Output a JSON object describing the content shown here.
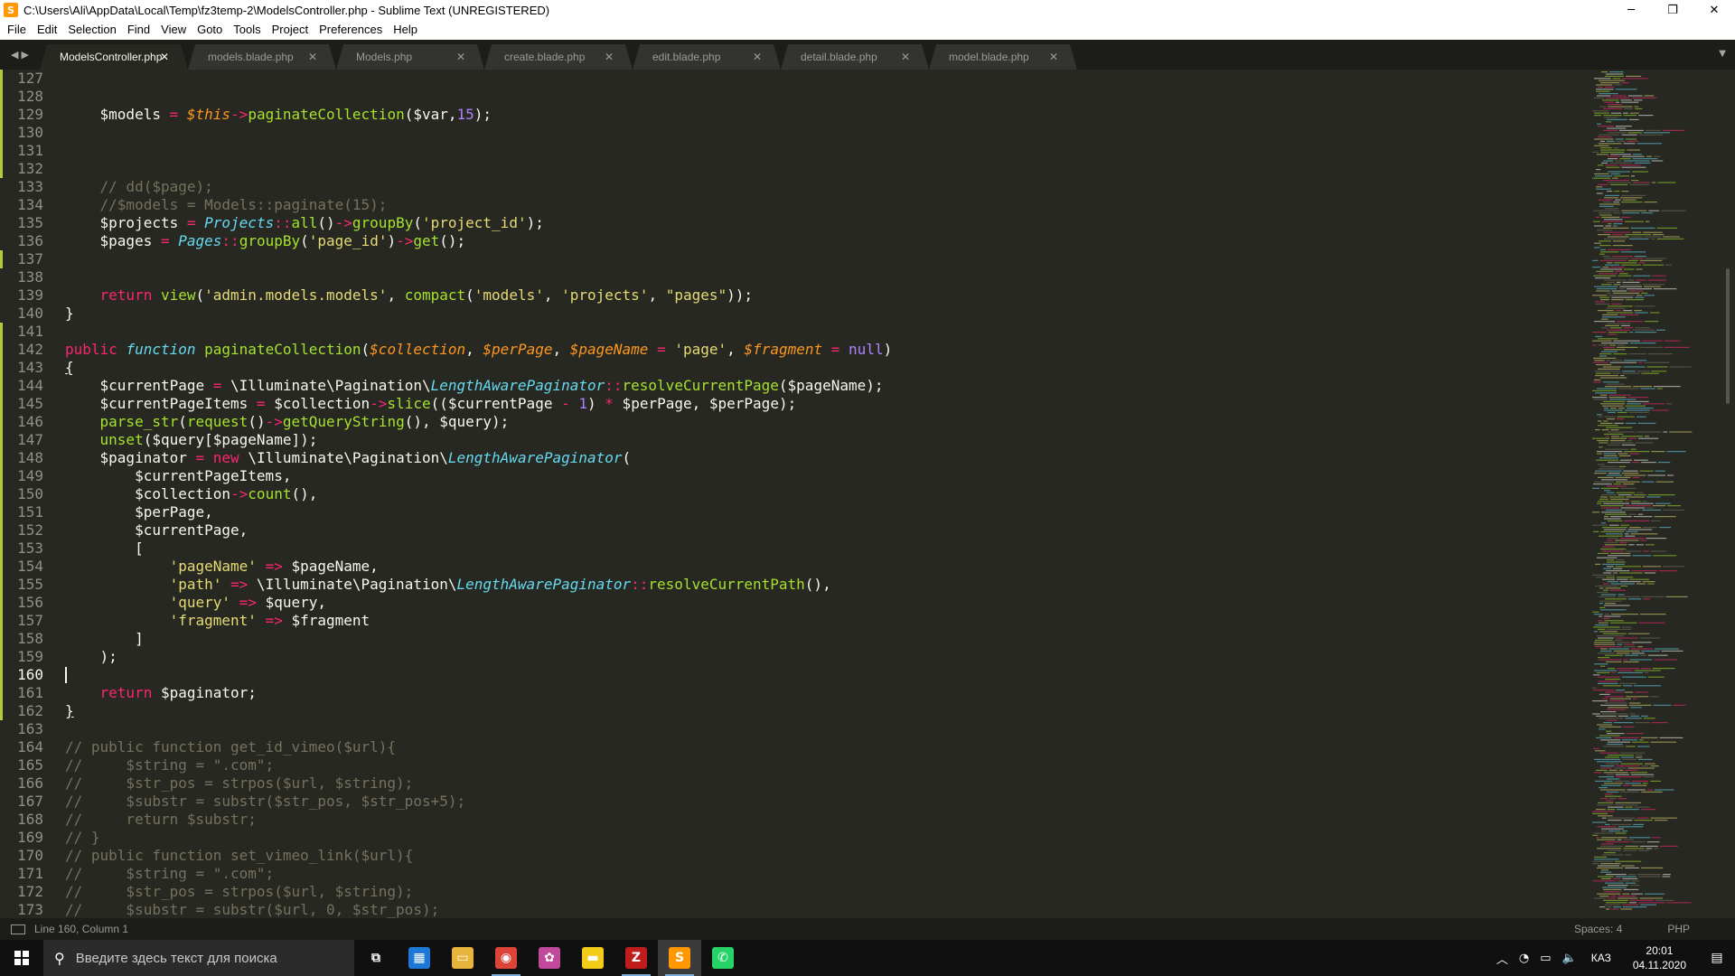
{
  "window": {
    "title": "C:\\Users\\Ali\\AppData\\Local\\Temp\\fz3temp-2\\ModelsController.php - Sublime Text (UNREGISTERED)",
    "app_icon_letter": "S",
    "minimize_glyph": "─",
    "maximize_glyph": "❐",
    "close_glyph": "✕"
  },
  "menu": [
    "File",
    "Edit",
    "Selection",
    "Find",
    "View",
    "Goto",
    "Tools",
    "Project",
    "Preferences",
    "Help"
  ],
  "tabs": [
    {
      "label": "ModelsController.php",
      "active": true
    },
    {
      "label": "models.blade.php",
      "active": false
    },
    {
      "label": "Models.php",
      "active": false
    },
    {
      "label": "create.blade.php",
      "active": false
    },
    {
      "label": "edit.blade.php",
      "active": false
    },
    {
      "label": "detail.blade.php",
      "active": false
    },
    {
      "label": "model.blade.php",
      "active": false
    }
  ],
  "tab_close_glyph": "✕",
  "nav_arrows": "◀ ▶",
  "tab_dropdown_glyph": "▼",
  "editor": {
    "first_line": 127,
    "current_line": 160,
    "modified_lines": [
      127,
      128,
      129,
      130,
      131,
      132,
      137,
      141,
      142,
      143,
      144,
      145,
      146,
      147,
      148,
      149,
      150,
      151,
      152,
      153,
      154,
      155,
      156,
      157,
      158,
      159,
      160,
      161,
      162
    ],
    "lines": [
      [],
      [],
      [
        [
          "    $models ",
          "var"
        ],
        [
          "=",
          "op"
        ],
        [
          " ",
          "var"
        ],
        [
          "$this",
          "this"
        ],
        [
          "->",
          "op"
        ],
        [
          "paginateCollection",
          "fn"
        ],
        [
          "($var,",
          "var"
        ],
        [
          "15",
          "num"
        ],
        [
          ");",
          "var"
        ]
      ],
      [],
      [],
      [],
      [
        [
          "    // dd($page);",
          "cm"
        ]
      ],
      [
        [
          "    //$models = Models::paginate(15);",
          "cm"
        ]
      ],
      [
        [
          "    $projects ",
          "var"
        ],
        [
          "=",
          "op"
        ],
        [
          " ",
          "var"
        ],
        [
          "Projects",
          "cls"
        ],
        [
          "::",
          "op"
        ],
        [
          "all",
          "fn"
        ],
        [
          "()",
          "var"
        ],
        [
          "->",
          "op"
        ],
        [
          "groupBy",
          "fn"
        ],
        [
          "(",
          "var"
        ],
        [
          "'project_id'",
          "str"
        ],
        [
          ");",
          "var"
        ]
      ],
      [
        [
          "    $pages ",
          "var"
        ],
        [
          "=",
          "op"
        ],
        [
          " ",
          "var"
        ],
        [
          "Pages",
          "cls"
        ],
        [
          "::",
          "op"
        ],
        [
          "groupBy",
          "fn"
        ],
        [
          "(",
          "var"
        ],
        [
          "'page_id'",
          "str"
        ],
        [
          ")",
          "var"
        ],
        [
          "->",
          "op"
        ],
        [
          "get",
          "fn"
        ],
        [
          "();",
          "var"
        ]
      ],
      [],
      [],
      [
        [
          "    ",
          "var"
        ],
        [
          "return",
          "kw"
        ],
        [
          " ",
          "var"
        ],
        [
          "view",
          "fn"
        ],
        [
          "(",
          "var"
        ],
        [
          "'admin.models.models'",
          "str"
        ],
        [
          ", ",
          "var"
        ],
        [
          "compact",
          "fn"
        ],
        [
          "(",
          "var"
        ],
        [
          "'models'",
          "str"
        ],
        [
          ", ",
          "var"
        ],
        [
          "'projects'",
          "str"
        ],
        [
          ", ",
          "var"
        ],
        [
          "\"pages\"",
          "str"
        ],
        [
          "));",
          "var"
        ]
      ],
      [
        [
          "}",
          "var"
        ]
      ],
      [],
      [
        [
          "public",
          "kw"
        ],
        [
          " ",
          "var"
        ],
        [
          "function",
          "st"
        ],
        [
          " ",
          "var"
        ],
        [
          "paginateCollection",
          "fn"
        ],
        [
          "(",
          "var"
        ],
        [
          "$collection",
          "param"
        ],
        [
          ", ",
          "var"
        ],
        [
          "$perPage",
          "param"
        ],
        [
          ", ",
          "var"
        ],
        [
          "$pageName",
          "param"
        ],
        [
          " ",
          "var"
        ],
        [
          "=",
          "op"
        ],
        [
          " ",
          "var"
        ],
        [
          "'page'",
          "str"
        ],
        [
          ", ",
          "var"
        ],
        [
          "$fragment",
          "param"
        ],
        [
          " ",
          "var"
        ],
        [
          "=",
          "op"
        ],
        [
          " ",
          "var"
        ],
        [
          "null",
          "num"
        ],
        [
          ")",
          "var"
        ]
      ],
      [
        [
          "{",
          "bracket"
        ]
      ],
      [
        [
          "    $currentPage ",
          "var"
        ],
        [
          "=",
          "op"
        ],
        [
          " \\Illuminate\\Pagination\\",
          "var"
        ],
        [
          "LengthAwarePaginator",
          "cls"
        ],
        [
          "::",
          "op"
        ],
        [
          "resolveCurrentPage",
          "fn"
        ],
        [
          "($pageName);",
          "var"
        ]
      ],
      [
        [
          "    $currentPageItems ",
          "var"
        ],
        [
          "=",
          "op"
        ],
        [
          " $collection",
          "var"
        ],
        [
          "->",
          "op"
        ],
        [
          "slice",
          "fn"
        ],
        [
          "(($currentPage ",
          "var"
        ],
        [
          "-",
          "op"
        ],
        [
          " ",
          "var"
        ],
        [
          "1",
          "num"
        ],
        [
          ") ",
          "var"
        ],
        [
          "*",
          "op"
        ],
        [
          " $perPage, $perPage);",
          "var"
        ]
      ],
      [
        [
          "    ",
          "var"
        ],
        [
          "parse_str",
          "fn"
        ],
        [
          "(",
          "var"
        ],
        [
          "request",
          "fn"
        ],
        [
          "()",
          "var"
        ],
        [
          "->",
          "op"
        ],
        [
          "getQueryString",
          "fn"
        ],
        [
          "(), $query);",
          "var"
        ]
      ],
      [
        [
          "    ",
          "var"
        ],
        [
          "unset",
          "fn"
        ],
        [
          "($query[$pageName]);",
          "var"
        ]
      ],
      [
        [
          "    $paginator ",
          "var"
        ],
        [
          "=",
          "op"
        ],
        [
          " ",
          "var"
        ],
        [
          "new",
          "kw"
        ],
        [
          " \\Illuminate\\Pagination\\",
          "var"
        ],
        [
          "LengthAwarePaginator",
          "cls"
        ],
        [
          "(",
          "var"
        ]
      ],
      [
        [
          "        $currentPageItems,",
          "var"
        ]
      ],
      [
        [
          "        $collection",
          "var"
        ],
        [
          "->",
          "op"
        ],
        [
          "count",
          "fn"
        ],
        [
          "(),",
          "var"
        ]
      ],
      [
        [
          "        $perPage,",
          "var"
        ]
      ],
      [
        [
          "        $currentPage,",
          "var"
        ]
      ],
      [
        [
          "        [",
          "var"
        ]
      ],
      [
        [
          "            ",
          "var"
        ],
        [
          "'pageName'",
          "str"
        ],
        [
          " ",
          "var"
        ],
        [
          "=>",
          "op"
        ],
        [
          " $pageName,",
          "var"
        ]
      ],
      [
        [
          "            ",
          "var"
        ],
        [
          "'path'",
          "str"
        ],
        [
          " ",
          "var"
        ],
        [
          "=>",
          "op"
        ],
        [
          " \\Illuminate\\Pagination\\",
          "var"
        ],
        [
          "LengthAwarePaginator",
          "cls"
        ],
        [
          "::",
          "op"
        ],
        [
          "resolveCurrentPath",
          "fn"
        ],
        [
          "(),",
          "var"
        ]
      ],
      [
        [
          "            ",
          "var"
        ],
        [
          "'query'",
          "str"
        ],
        [
          " ",
          "var"
        ],
        [
          "=>",
          "op"
        ],
        [
          " $query,",
          "var"
        ]
      ],
      [
        [
          "            ",
          "var"
        ],
        [
          "'fragment'",
          "str"
        ],
        [
          " ",
          "var"
        ],
        [
          "=>",
          "op"
        ],
        [
          " $fragment",
          "var"
        ]
      ],
      [
        [
          "        ]",
          "var"
        ]
      ],
      [
        [
          "    );",
          "var"
        ]
      ],
      [],
      [
        [
          "    ",
          "var"
        ],
        [
          "return",
          "kw"
        ],
        [
          " $paginator;",
          "var"
        ]
      ],
      [
        [
          "}",
          "bracket"
        ]
      ],
      [],
      [
        [
          "// public function get_id_vimeo($url){",
          "cm"
        ]
      ],
      [
        [
          "//     $string = \".com\";",
          "cm"
        ]
      ],
      [
        [
          "//     $str_pos = strpos($url, $string);",
          "cm"
        ]
      ],
      [
        [
          "//     $substr = substr($str_pos, $str_pos+5);",
          "cm"
        ]
      ],
      [
        [
          "//     return $substr;",
          "cm"
        ]
      ],
      [
        [
          "// }",
          "cm"
        ]
      ],
      [
        [
          "// public function set_vimeo_link($url){",
          "cm"
        ]
      ],
      [
        [
          "//     $string = \".com\";",
          "cm"
        ]
      ],
      [
        [
          "//     $str_pos = strpos($url, $string);",
          "cm"
        ]
      ],
      [
        [
          "//     $substr = substr($url, 0, $str_pos);",
          "cm"
        ]
      ]
    ]
  },
  "status": {
    "position": "Line 160, Column 1",
    "spaces": "Spaces: 4",
    "syntax": "PHP"
  },
  "taskbar": {
    "search_placeholder": "Введите здесь текст для поиска",
    "search_glyph": "⚲",
    "apps": [
      {
        "name": "task-view",
        "glyph": "⧉",
        "color": "#101010",
        "running": false,
        "active": false
      },
      {
        "name": "calendar-app",
        "glyph": "▦",
        "color": "#1e78d7",
        "running": false,
        "active": false
      },
      {
        "name": "file-explorer",
        "glyph": "▭",
        "color": "#e8b53a",
        "running": false,
        "active": false
      },
      {
        "name": "chrome",
        "glyph": "◉",
        "color": "#db4437",
        "running": true,
        "active": false
      },
      {
        "name": "brain-app",
        "glyph": "✿",
        "color": "#c2489b",
        "running": false,
        "active": false
      },
      {
        "name": "sticky-notes",
        "glyph": "▬",
        "color": "#f3cc1a",
        "running": false,
        "active": false
      },
      {
        "name": "filezilla",
        "glyph": "Z",
        "color": "#bf1d1d",
        "running": true,
        "active": false
      },
      {
        "name": "sublime-text",
        "glyph": "S",
        "color": "#ff9800",
        "running": true,
        "active": true
      },
      {
        "name": "whatsapp",
        "glyph": "✆",
        "color": "#25d366",
        "running": false,
        "active": false
      }
    ],
    "tray_chevron": "︿",
    "tray_network": "◔",
    "tray_battery": "▭",
    "tray_volume": "🔈",
    "language": "КАЗ",
    "time": "20:01",
    "date": "04.11.2020",
    "notification_glyph": "▤"
  }
}
